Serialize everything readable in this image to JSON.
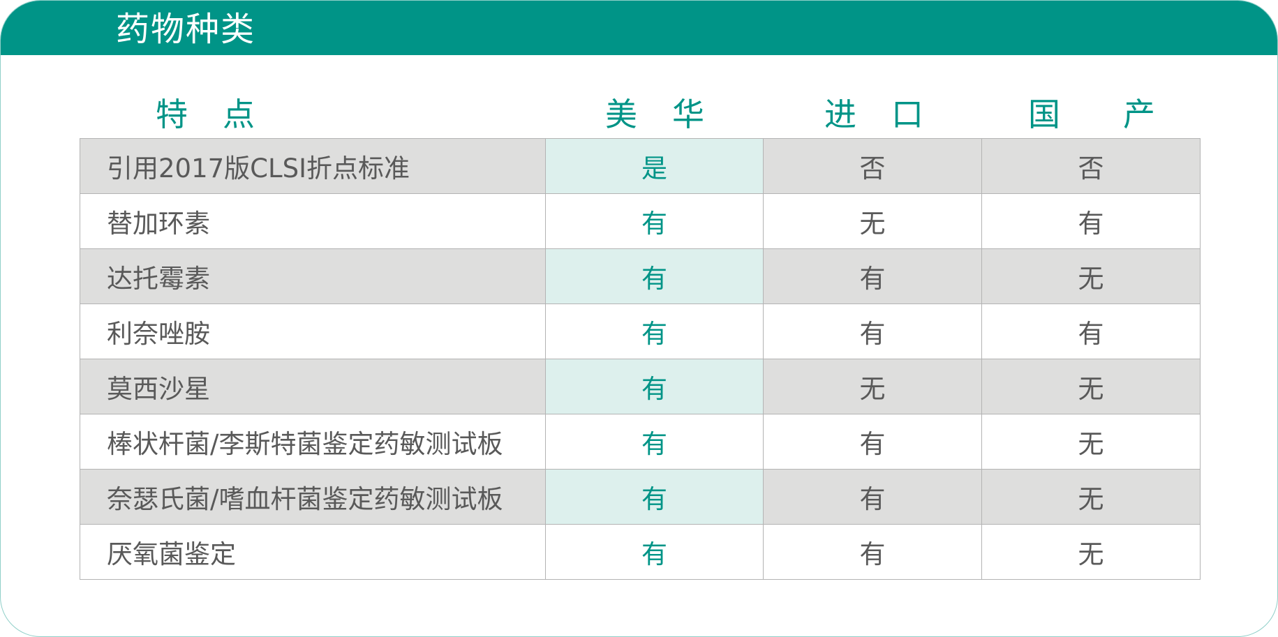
{
  "header": {
    "title": "药物种类"
  },
  "columns": [
    {
      "chars": [
        "特",
        "点"
      ]
    },
    {
      "chars": [
        "美",
        "华"
      ]
    },
    {
      "chars": [
        "进",
        "口"
      ]
    },
    {
      "chars": [
        "国",
        "产"
      ]
    }
  ],
  "rows": [
    {
      "feature": "引用2017版CLSI折点标准",
      "meihua": "是",
      "imported": "否",
      "domestic": "否"
    },
    {
      "feature": "替加环素",
      "meihua": "有",
      "imported": "无",
      "domestic": "有"
    },
    {
      "feature": "达托霉素",
      "meihua": "有",
      "imported": "有",
      "domestic": "无"
    },
    {
      "feature": "利奈唑胺",
      "meihua": "有",
      "imported": "有",
      "domestic": "有"
    },
    {
      "feature": "莫西沙星",
      "meihua": "有",
      "imported": "无",
      "domestic": "无"
    },
    {
      "feature": "棒状杆菌/李斯特菌鉴定药敏测试板",
      "meihua": "有",
      "imported": "有",
      "domestic": "无"
    },
    {
      "feature": "奈瑟氏菌/嗜血杆菌鉴定药敏测试板",
      "meihua": "有",
      "imported": "有",
      "domestic": "无"
    },
    {
      "feature": "厌氧菌鉴定",
      "meihua": "有",
      "imported": "有",
      "domestic": "无"
    }
  ],
  "colors": {
    "brand_teal": "#009487",
    "row_shade": "#dededd",
    "highlight_shade": "#ddf0ed",
    "text_gray": "#595959"
  }
}
